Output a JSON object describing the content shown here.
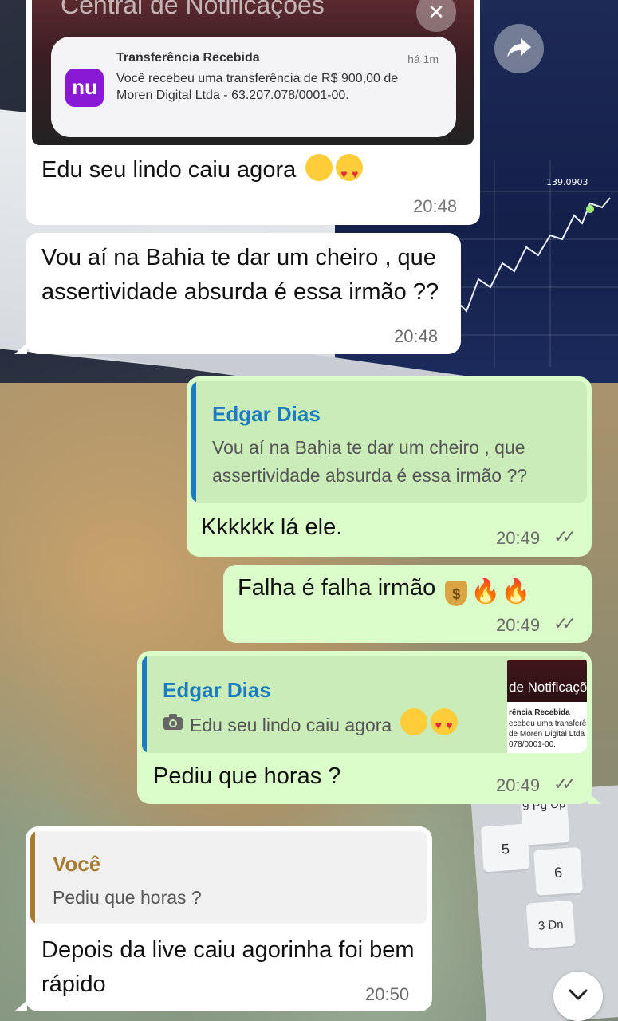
{
  "colors": {
    "bubble_in": "#ffffff",
    "bubble_out": "#dafdc9",
    "quote_green": "#c9ecb8",
    "quote_author_blue": "#1c7cbf",
    "quote_author_gold": "#a87a32",
    "nubank_purple": "#8a19d6"
  },
  "notification": {
    "center_title": "Central de Notificações",
    "app_logo_text": "nu",
    "title": "Transferência Recebida",
    "time": "há 1m",
    "body": "Você recebeu uma transferência de R$ 900,00 de Moren Digital Ltda - 63.207.078/0001-00."
  },
  "messages": [
    {
      "id": "m1",
      "direction": "in",
      "text": "Edu seu lindo caiu agora",
      "emojis": [
        "pinching-hand-face",
        "heart-eyes"
      ],
      "time": "20:48"
    },
    {
      "id": "m2",
      "direction": "in",
      "text": "Vou aí na Bahia te dar um cheiro , que assertividade absurda é essa irmão ??",
      "time": "20:48"
    },
    {
      "id": "m3",
      "direction": "out",
      "quote": {
        "author": "Edgar Dias",
        "text": "Vou aí na Bahia te dar um cheiro , que assertividade absurda é essa irmão ??"
      },
      "text": "Kkkkkk lá ele.",
      "time": "20:49",
      "status": "read"
    },
    {
      "id": "m4",
      "direction": "out",
      "text": "Falha é falha irmão",
      "emojis": [
        "money-bag",
        "fire",
        "fire"
      ],
      "time": "20:49",
      "status": "read"
    },
    {
      "id": "m5",
      "direction": "out",
      "quote": {
        "author": "Edgar Dias",
        "text": "Edu seu lindo caiu agora",
        "has_photo": true,
        "thumb_title": "de Notificaçõ",
        "thumb_lines": [
          "rência Recebida",
          "ecebeu uma transferênc",
          "de Moren Digital Ltda -",
          "078/0001-00."
        ]
      },
      "text": "Pediu que horas ?",
      "time": "20:49",
      "status": "read"
    },
    {
      "id": "m6",
      "direction": "in",
      "quote": {
        "author": "Você",
        "text": "Pediu que horas ?"
      },
      "text": "Depois da live caiu agorinha foi bem rápido",
      "time": "20:50"
    }
  ],
  "background_chart": {
    "price_label": "139.0903"
  },
  "background_keys": [
    "9 Pg Up",
    "5",
    "6",
    "3 Dn"
  ]
}
